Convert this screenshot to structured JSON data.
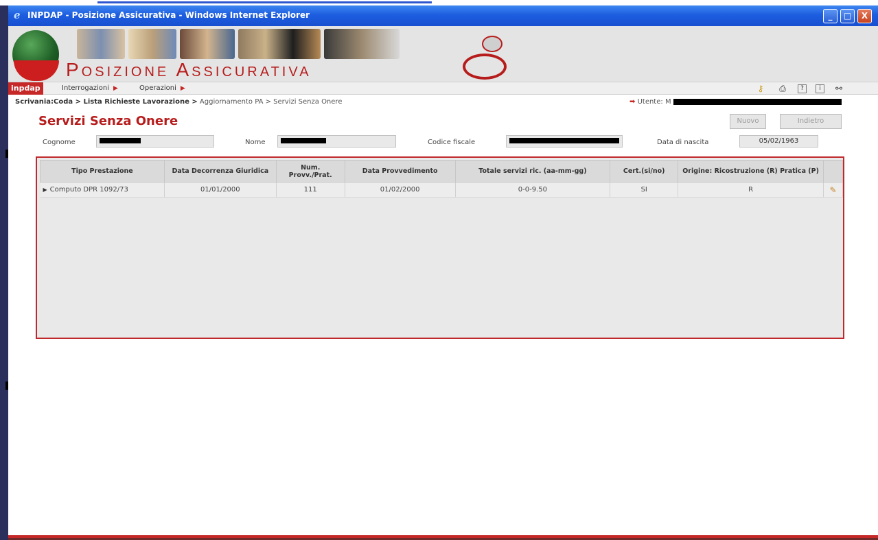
{
  "window": {
    "title": "INPDAP - Posizione Assicurativa - Windows Internet Explorer",
    "buttons": {
      "minimize": "_",
      "maximize": "□",
      "close": "X"
    }
  },
  "banner": {
    "app_title": "Posizione Assicurativa",
    "brand": "inpdap"
  },
  "menu": {
    "items": [
      "Interrogazioni",
      "Operazioni"
    ],
    "arrow": "▶",
    "tools": [
      {
        "name": "key-icon",
        "glyph": "⚷"
      },
      {
        "name": "print-icon",
        "glyph": "⎙"
      },
      {
        "name": "help-icon",
        "glyph": "?"
      },
      {
        "name": "info-icon",
        "glyph": "i"
      },
      {
        "name": "binoculars-icon",
        "glyph": "⚯"
      }
    ]
  },
  "breadcrumb": {
    "bold": "Scrivania:Coda > Lista Richieste Lavorazione >",
    "rest": "Aggiornamento PA > Servizi Senza Onere"
  },
  "user": {
    "label": "Utente:",
    "initial": "M"
  },
  "page": {
    "title": "Servizi Senza Onere",
    "buttons": {
      "new": "Nuovo",
      "back": "Indietro"
    }
  },
  "filters": {
    "surname_label": "Cognome",
    "name_label": "Nome",
    "fiscal_code_label": "Codice fiscale",
    "birth_label": "Data di nascita",
    "birth_value": "05/02/1963"
  },
  "table": {
    "headers": [
      "Tipo Prestazione",
      "Data Decorrenza Giuridica",
      "Num. Provv./Prat.",
      "Data Provvedimento",
      "Totale servizi ric. (aa-mm-gg)",
      "Cert.(si/no)",
      "Origine: Ricostruzione (R) Pratica (P)"
    ],
    "rows": [
      [
        "Computo DPR 1092/73",
        "01/01/2000",
        "111",
        "01/02/2000",
        "0-0-9.50",
        "SI",
        "R"
      ]
    ]
  },
  "colors": {
    "accent": "#c62828",
    "titlebar": "#1d5ee0",
    "panel_border": "#c0292b"
  }
}
